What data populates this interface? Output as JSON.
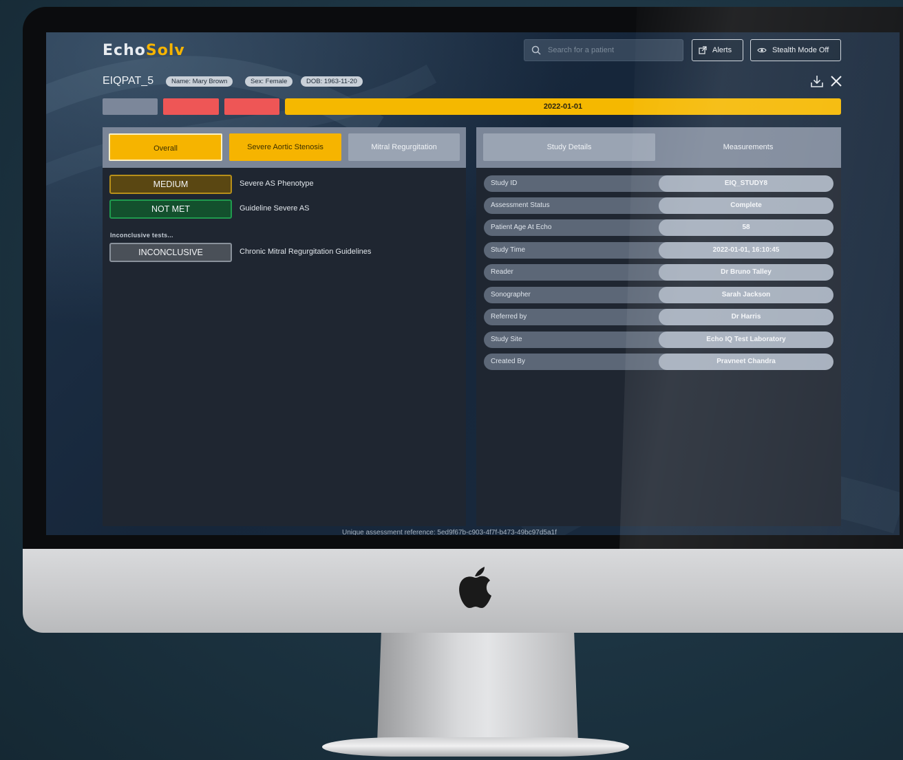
{
  "app": {
    "logo_main": "Echo",
    "logo_accent": "Solv",
    "search_placeholder": "Search for a patient",
    "alerts_label": "Alerts",
    "stealth_label": "Stealth Mode Off"
  },
  "patient": {
    "id": "EIQPAT_5",
    "chips": [
      "Name: Mary Brown",
      "Sex: Female",
      "DOB: 1963-11-20"
    ]
  },
  "timeline": {
    "selected_date": "2022-01-01",
    "colors": {
      "neutral": "#7c879a",
      "alert": "#ee5656",
      "selected": "#f5b800"
    }
  },
  "left_panel": {
    "tabs": [
      "Overall",
      "Severe Aortic Stenosis",
      "Mitral Regurgitation"
    ],
    "results": [
      {
        "badge": "MEDIUM",
        "text": "Severe AS Phenotype",
        "color": "#b8901a",
        "bg": "#5a4712"
      },
      {
        "badge": "NOT MET",
        "text": "Guideline Severe AS",
        "color": "#1f9b4e",
        "bg": "#13502d"
      }
    ],
    "inconclusive_label": "Inconclusive tests...",
    "inconclusive": {
      "badge": "INCONCLUSIVE",
      "text": "Chronic Mitral Regurgitation Guidelines"
    }
  },
  "right_panel": {
    "tabs": [
      "Study Details",
      "Measurements"
    ],
    "details": [
      {
        "key": "Study ID",
        "value": "EIQ_STUDY8"
      },
      {
        "key": "Assessment Status",
        "value": "Complete"
      },
      {
        "key": "Patient Age At Echo",
        "value": "58"
      },
      {
        "key": "Study Time",
        "value": "2022-01-01, 16:10:45"
      },
      {
        "key": "Reader",
        "value": "Dr Bruno Talley"
      },
      {
        "key": "Sonographer",
        "value": "Sarah Jackson"
      },
      {
        "key": "Referred by",
        "value": "Dr Harris"
      },
      {
        "key": "Study Site",
        "value": "Echo IQ Test Laboratory"
      },
      {
        "key": "Created By",
        "value": "Pravneet Chandra"
      }
    ]
  },
  "footer": {
    "reference": "Unique assessment reference: 5ed9f67b-c903-4f7f-b473-49bc97d5a1f"
  }
}
